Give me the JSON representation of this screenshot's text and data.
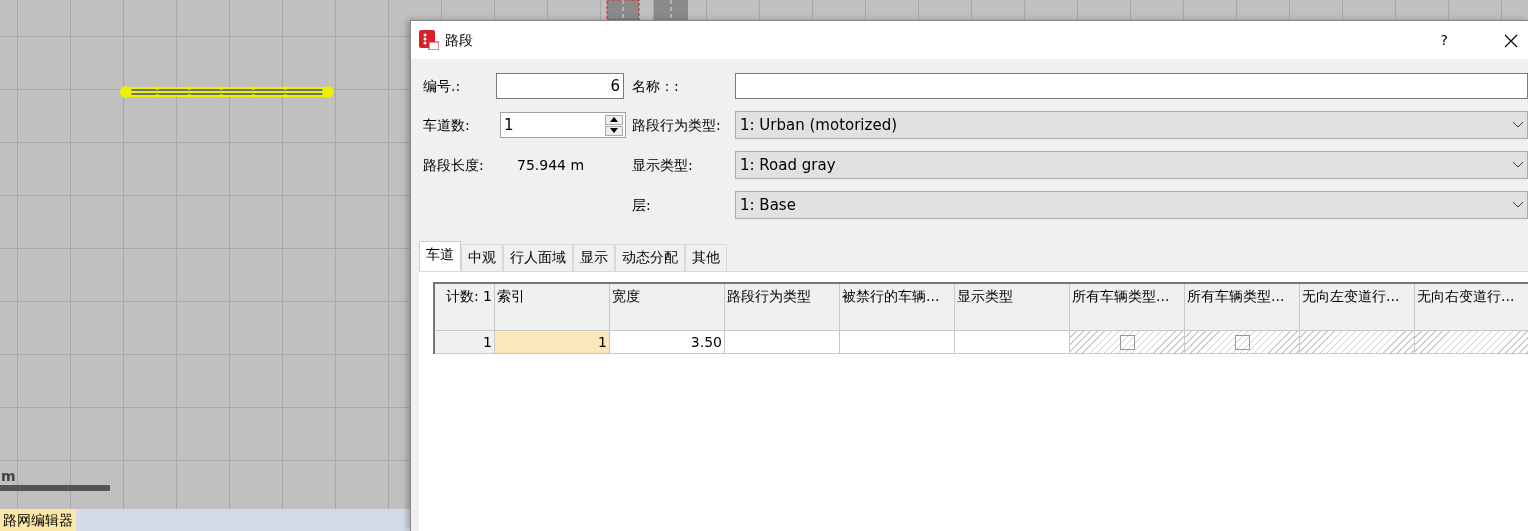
{
  "canvas": {
    "scale_unit": "m"
  },
  "status_bar": {
    "label": "路网编辑器",
    "highlighted": true
  },
  "dialog": {
    "title": "路段",
    "help": "?",
    "form": {
      "number": {
        "label": "编号.:",
        "value": "6"
      },
      "name": {
        "label": "名称：:"
      },
      "lanes": {
        "label": "车道数:",
        "value": "1"
      },
      "length": {
        "label": "路段长度:",
        "value": "75.944 m"
      },
      "behavior": {
        "label": "路段行为类型:",
        "value": "1: Urban (motorized)"
      },
      "display": {
        "label": "显示类型:",
        "value": "1: Road gray"
      },
      "layer": {
        "label": "层:",
        "value": "1: Base"
      }
    },
    "tabs": [
      {
        "label": "车道",
        "selected": true
      },
      {
        "label": "中观",
        "selected": false
      },
      {
        "label": "行人面域",
        "selected": false
      },
      {
        "label": "显示",
        "selected": false
      },
      {
        "label": "动态分配",
        "selected": false
      },
      {
        "label": "其他",
        "selected": false
      }
    ],
    "table": {
      "corner": "计数: 1",
      "columns": [
        "索引",
        "宽度",
        "路段行为类型",
        "被禁行的车辆...",
        "显示类型",
        "所有车辆类型...",
        "所有车辆类型...",
        "无向左变道行...",
        "无向右变道行..."
      ],
      "rows": [
        {
          "header": "1",
          "cells": [
            {
              "kind": "text",
              "text": "1",
              "selected": true
            },
            {
              "kind": "text",
              "text": "3.50",
              "selected": false
            },
            {
              "kind": "empty",
              "selected": false
            },
            {
              "kind": "empty",
              "selected": false
            },
            {
              "kind": "empty",
              "selected": false
            },
            {
              "kind": "checkbox",
              "checked": false,
              "selected": false
            },
            {
              "kind": "checkbox",
              "checked": false,
              "selected": false
            },
            {
              "kind": "hatched",
              "selected": false
            },
            {
              "kind": "hatched",
              "selected": false
            }
          ]
        }
      ]
    }
  }
}
